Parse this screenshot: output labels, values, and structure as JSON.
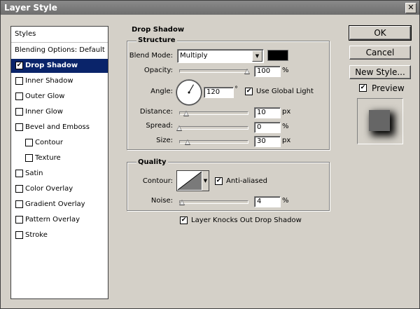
{
  "window": {
    "title": "Layer Style",
    "close_glyph": "✕"
  },
  "styles_list": {
    "header": "Styles",
    "items": [
      {
        "label": "Blending Options: Default",
        "has_checkbox": false,
        "checked": false,
        "selected": false
      },
      {
        "label": "Drop Shadow",
        "has_checkbox": true,
        "checked": true,
        "selected": true
      },
      {
        "label": "Inner Shadow",
        "has_checkbox": true,
        "checked": false,
        "selected": false
      },
      {
        "label": "Outer Glow",
        "has_checkbox": true,
        "checked": false,
        "selected": false
      },
      {
        "label": "Inner Glow",
        "has_checkbox": true,
        "checked": false,
        "selected": false
      },
      {
        "label": "Bevel and Emboss",
        "has_checkbox": true,
        "checked": false,
        "selected": false
      },
      {
        "label": "Contour",
        "has_checkbox": true,
        "checked": false,
        "selected": false,
        "indent": true
      },
      {
        "label": "Texture",
        "has_checkbox": true,
        "checked": false,
        "selected": false,
        "indent": true
      },
      {
        "label": "Satin",
        "has_checkbox": true,
        "checked": false,
        "selected": false
      },
      {
        "label": "Color Overlay",
        "has_checkbox": true,
        "checked": false,
        "selected": false
      },
      {
        "label": "Gradient Overlay",
        "has_checkbox": true,
        "checked": false,
        "selected": false
      },
      {
        "label": "Pattern Overlay",
        "has_checkbox": true,
        "checked": false,
        "selected": false
      },
      {
        "label": "Stroke",
        "has_checkbox": true,
        "checked": false,
        "selected": false
      }
    ]
  },
  "drop_shadow": {
    "section_title": "Drop Shadow",
    "structure": {
      "title": "Structure",
      "blend_mode_label": "Blend Mode:",
      "blend_mode_value": "Multiply",
      "shadow_color": "#000000",
      "opacity_label": "Opacity:",
      "opacity_value": "100",
      "opacity_unit": "%",
      "opacity_fraction": 1.0,
      "angle_label": "Angle:",
      "angle_value": "120",
      "angle_unit": "°",
      "use_global_light_label": "Use Global Light",
      "use_global_light_checked": true,
      "distance_label": "Distance:",
      "distance_value": "10",
      "distance_unit": "px",
      "distance_fraction": 0.1,
      "spread_label": "Spread:",
      "spread_value": "0",
      "spread_unit": "%",
      "spread_fraction": 0.0,
      "size_label": "Size:",
      "size_value": "30",
      "size_unit": "px",
      "size_fraction": 0.12
    },
    "quality": {
      "title": "Quality",
      "contour_label": "Contour:",
      "anti_aliased_label": "Anti-aliased",
      "anti_aliased_checked": true,
      "noise_label": "Noise:",
      "noise_value": "4",
      "noise_unit": "%",
      "noise_fraction": 0.04
    },
    "knockout_label": "Layer Knocks Out Drop Shadow",
    "knockout_checked": true
  },
  "buttons": {
    "ok": "OK",
    "cancel": "Cancel",
    "new_style": "New Style...",
    "preview_label": "Preview",
    "preview_checked": true
  },
  "icons": {
    "checkmark": "✔",
    "dropdown_arrow": "▼"
  }
}
